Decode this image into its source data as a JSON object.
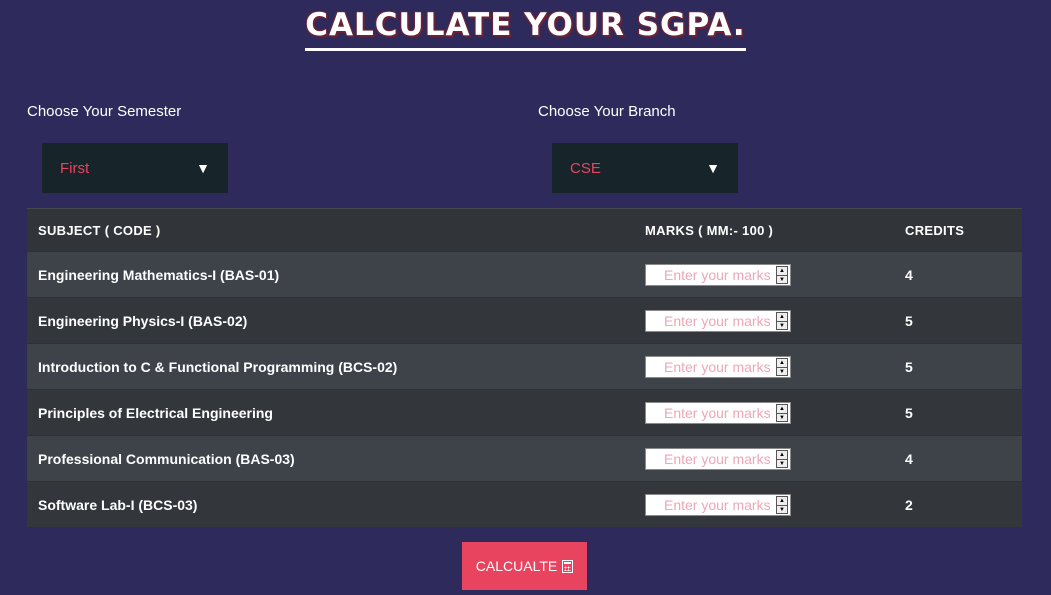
{
  "page": {
    "title": "CALCULATE YOUR SGPA."
  },
  "semester": {
    "label": "Choose Your Semester",
    "selected": "First"
  },
  "branch": {
    "label": "Choose Your Branch",
    "selected": "CSE"
  },
  "table": {
    "headers": {
      "subject": "SUBJECT ( CODE )",
      "marks": "MARKS ( MM:- 100 )",
      "credits": "CREDITS"
    },
    "marks_placeholder": "Enter your marks",
    "rows": [
      {
        "subject": "Engineering Mathematics-I (BAS-01)",
        "credits": "4"
      },
      {
        "subject": "Engineering Physics-I (BAS-02)",
        "credits": "5"
      },
      {
        "subject": "Introduction to C & Functional Programming (BCS-02)",
        "credits": "5"
      },
      {
        "subject": "Principles of Electrical Engineering",
        "credits": "5"
      },
      {
        "subject": "Professional Communication (BAS-03)",
        "credits": "4"
      },
      {
        "subject": "Software Lab-I (BCS-03)",
        "credits": "2"
      }
    ]
  },
  "calculate_button": {
    "label": "CALCUALTE",
    "icon": "calculator-icon"
  },
  "colors": {
    "background": "#2e2a5b",
    "accent": "#e8445f",
    "select_bg": "#17242a",
    "table_odd": "#3e4349",
    "table_even": "#33373c"
  }
}
